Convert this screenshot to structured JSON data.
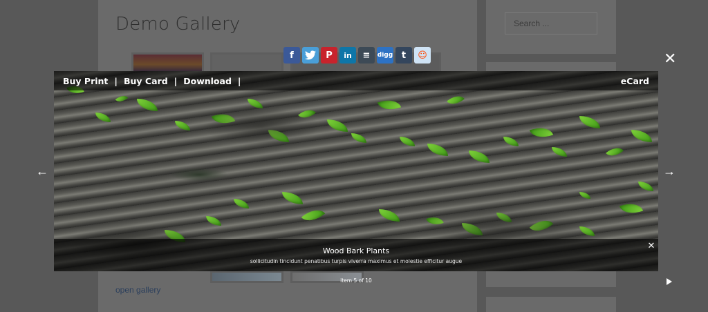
{
  "page": {
    "title": "Demo Gallery",
    "open_gallery_link": "open gallery",
    "search": {
      "placeholder": "Search ..."
    }
  },
  "share_bar": {
    "buttons": [
      {
        "icon": "facebook-icon",
        "glyph": "f",
        "color": "#3b5998"
      },
      {
        "icon": "twitter-icon",
        "glyph": "t",
        "color": "#4a9fd8"
      },
      {
        "icon": "pinterest-icon",
        "glyph": "P",
        "color": "#c8232c"
      },
      {
        "icon": "linkedin-icon",
        "glyph": "in",
        "color": "#0e76a8"
      },
      {
        "icon": "buffer-icon",
        "glyph": "≡",
        "color": "#3d4a56"
      },
      {
        "icon": "digg-icon",
        "glyph": "digg",
        "color": "#2d72c4"
      },
      {
        "icon": "tumblr-icon",
        "glyph": "t",
        "color": "#34465d"
      },
      {
        "icon": "reddit-icon",
        "glyph": "☺",
        "color": "#cfe3f5"
      }
    ]
  },
  "lightbox": {
    "menu": {
      "buy_print": "Buy Print",
      "buy_card": "Buy Card",
      "download": "Download",
      "separator": "|",
      "ecard": "eCard"
    },
    "caption": {
      "title": "Wood Bark Plants",
      "description": "sollicitudin tincidunt penatibus turpis viverra maximus et molestie efficitur augue"
    },
    "counter": "item 5 of 10",
    "close_glyph": "✕",
    "prev_glyph": "←",
    "next_glyph": "→"
  }
}
